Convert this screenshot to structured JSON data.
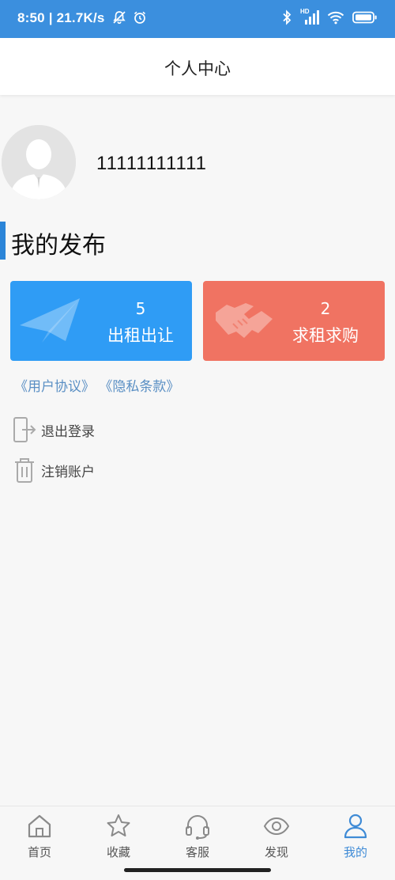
{
  "status_bar": {
    "time_speed": "8:50 | 21.7K/s",
    "icons": [
      "mute-icon",
      "alarm-icon",
      "bluetooth-icon",
      "signal-icon",
      "wifi-icon",
      "battery-icon"
    ],
    "signal_label": "HD"
  },
  "header": {
    "title": "个人中心"
  },
  "profile": {
    "username": "11111111111"
  },
  "section": {
    "title": "我的发布"
  },
  "cards": {
    "rent": {
      "count": "5",
      "label": "出租出让",
      "color": "#2f9cf5",
      "icon": "paper-plane-icon"
    },
    "want": {
      "count": "2",
      "label": "求租求购",
      "color": "#f07362",
      "icon": "handshake-icon"
    }
  },
  "links": {
    "user_agreement": "《用户协议》",
    "privacy": "《隐私条款》"
  },
  "menu": {
    "logout": {
      "label": "退出登录",
      "icon": "logout-icon"
    },
    "delete_account": {
      "label": "注销账户",
      "icon": "trash-icon"
    }
  },
  "bottom_nav": {
    "items": [
      {
        "label": "首页",
        "icon": "home-icon"
      },
      {
        "label": "收藏",
        "icon": "star-icon"
      },
      {
        "label": "客服",
        "icon": "headset-icon"
      },
      {
        "label": "发现",
        "icon": "eye-icon"
      },
      {
        "label": "我的",
        "icon": "user-icon",
        "active": true
      }
    ],
    "active_color": "#3f8bd6"
  }
}
